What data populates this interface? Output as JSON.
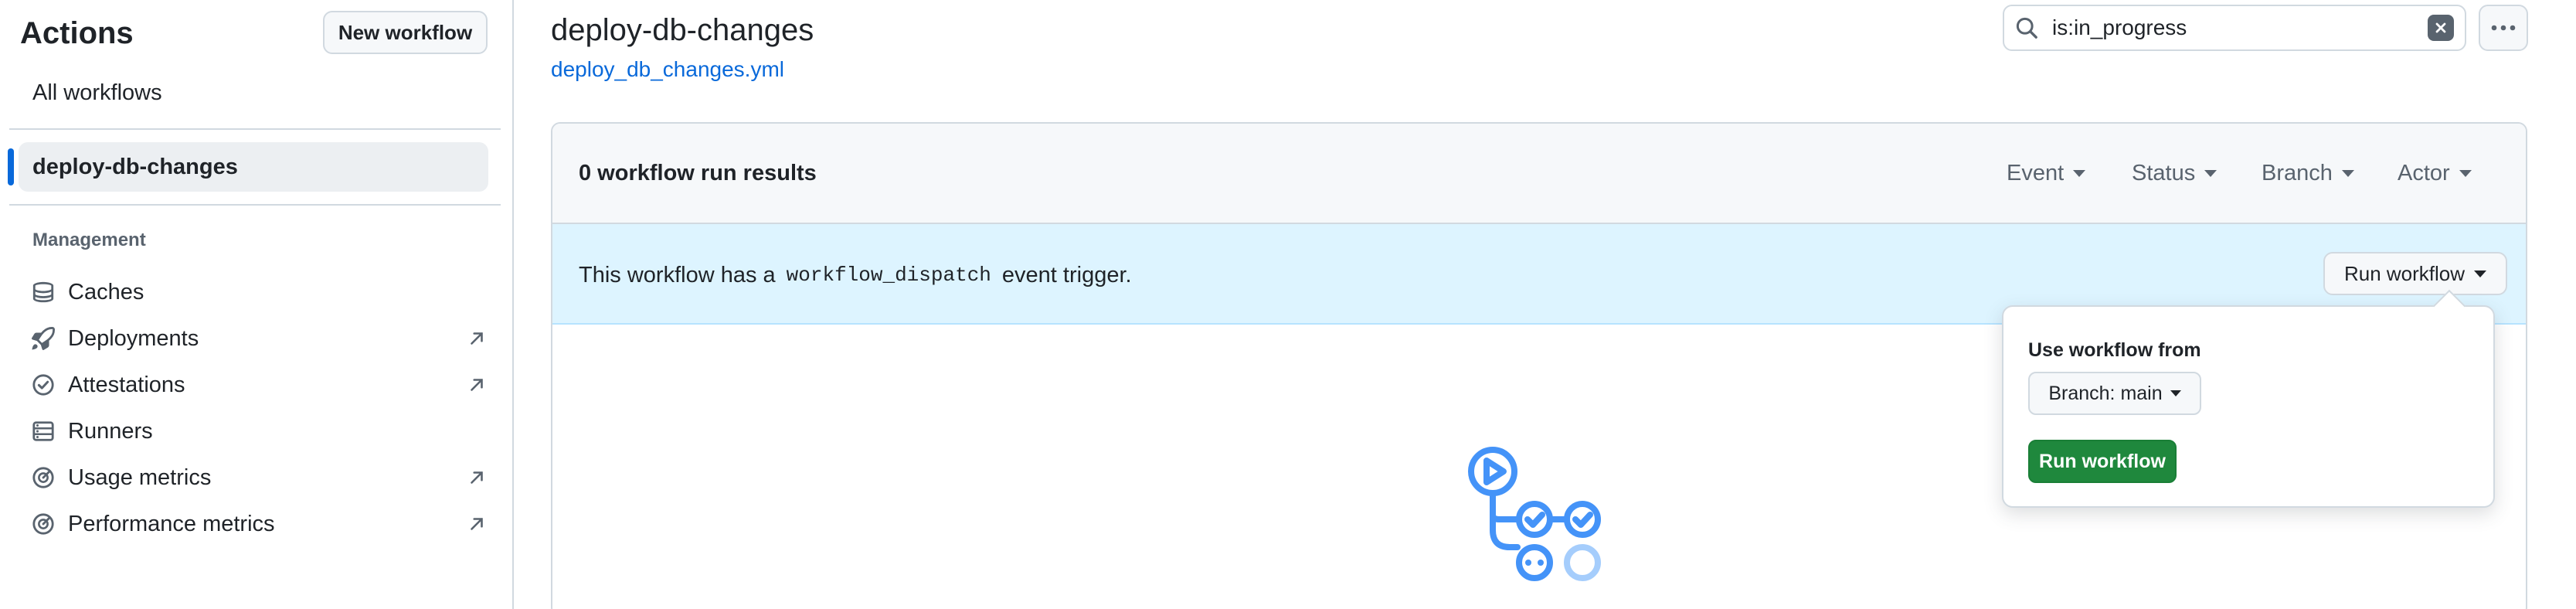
{
  "sidebar": {
    "title": "Actions",
    "new_workflow_label": "New workflow",
    "all_workflows_label": "All workflows",
    "active_workflow_label": "deploy-db-changes",
    "management_heading": "Management",
    "items": [
      {
        "label": "Caches",
        "icon": "database-icon",
        "external": false
      },
      {
        "label": "Deployments",
        "icon": "rocket-icon",
        "external": true
      },
      {
        "label": "Attestations",
        "icon": "verified-icon",
        "external": true
      },
      {
        "label": "Runners",
        "icon": "server-icon",
        "external": false
      },
      {
        "label": "Usage metrics",
        "icon": "meter-icon",
        "external": true
      },
      {
        "label": "Performance metrics",
        "icon": "meter-icon",
        "external": true
      }
    ]
  },
  "header": {
    "title": "deploy-db-changes",
    "workflow_file": "deploy_db_changes.yml",
    "search_value": "is:in_progress"
  },
  "results": {
    "summary": "0 workflow run results",
    "filters": [
      "Event",
      "Status",
      "Branch",
      "Actor"
    ]
  },
  "banner": {
    "prefix": "This workflow has a",
    "code": "workflow_dispatch",
    "suffix": "event trigger.",
    "run_button_label": "Run workflow"
  },
  "popover": {
    "label": "Use workflow from",
    "branch_button_label": "Branch: main",
    "submit_label": "Run workflow"
  },
  "colors": {
    "accent": "#0969da",
    "primary_button": "#1f883d",
    "banner_bg": "#ddf4ff",
    "illustration": "#4493f8"
  }
}
